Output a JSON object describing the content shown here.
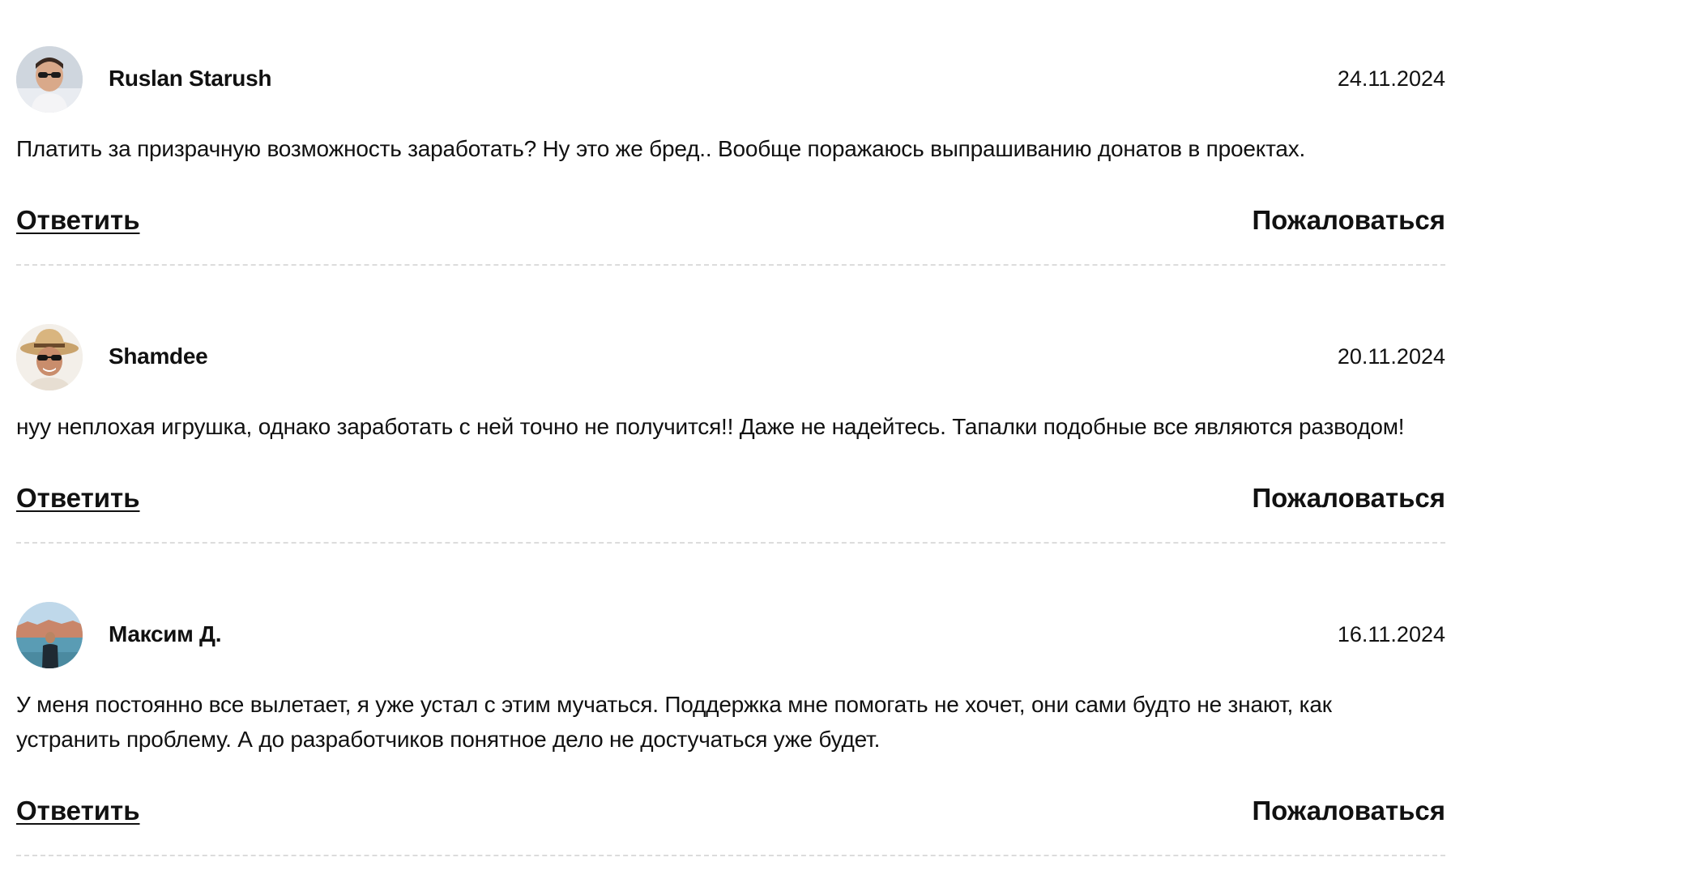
{
  "comments": [
    {
      "author": "Ruslan Starush",
      "date": "24.11.2024",
      "text": "Платить за призрачную возможность заработать? Ну это же бред.. Вообще поражаюсь выпрашиванию донатов в проектах.",
      "reply_label": "Ответить",
      "report_label": "Пожаловаться",
      "avatar": "man-with-sunglasses-photo"
    },
    {
      "author": "Shamdee",
      "date": "20.11.2024",
      "text": "нуу неплохая игрушка, однако заработать с ней точно не получится!! Даже не надейтесь. Тапалки подобные все являются разводом!",
      "reply_label": "Ответить",
      "report_label": "Пожаловаться",
      "avatar": "man-with-hat-photo"
    },
    {
      "author": "Максим Д.",
      "date": "16.11.2024",
      "text": "У меня постоянно все вылетает, я уже устал с этим мучаться. Поддержка мне помогать не хочет, они сами будто не знают, как устранить проблему. А до разработчиков понятное дело не достучаться уже будет.",
      "reply_label": "Ответить",
      "report_label": "Пожаловаться",
      "avatar": "man-at-seaside-photo"
    }
  ],
  "colors": {
    "text": "#111111",
    "divider": "#dcdcdc",
    "background": "#ffffff"
  }
}
